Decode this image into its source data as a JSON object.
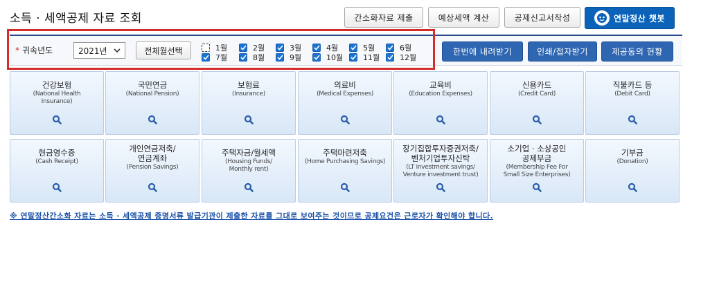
{
  "page": {
    "title": "소득 · 세액공제 자료 조회"
  },
  "header": {
    "simplified_submit": "간소화자료 제출",
    "tax_estimate": "예상세액 계산",
    "deduction_report": "공제신고서작성",
    "chatbot": "연말정산 챗봇"
  },
  "filter": {
    "year_label": "귀속년도",
    "required_mark": "*",
    "year_value": "2021년",
    "select_all": "전체월선택",
    "months": [
      {
        "label": "1월",
        "checked": false
      },
      {
        "label": "2월",
        "checked": true
      },
      {
        "label": "3월",
        "checked": true
      },
      {
        "label": "4월",
        "checked": true
      },
      {
        "label": "5월",
        "checked": true
      },
      {
        "label": "6월",
        "checked": true
      },
      {
        "label": "7월",
        "checked": true
      },
      {
        "label": "8월",
        "checked": true
      },
      {
        "label": "9월",
        "checked": true
      },
      {
        "label": "10월",
        "checked": true
      },
      {
        "label": "11월",
        "checked": true
      },
      {
        "label": "12월",
        "checked": true
      }
    ]
  },
  "actions": {
    "download_all": "한번에 내려받기",
    "print": "인쇄/접자받기",
    "consent_status": "제공동의 현황"
  },
  "tiles": [
    {
      "title": "건강보험",
      "sub": [
        "(National Health",
        "Insurance)"
      ]
    },
    {
      "title": "국민연금",
      "sub": [
        "(National Pension)"
      ]
    },
    {
      "title": "보험료",
      "sub": [
        "(Insurance)"
      ]
    },
    {
      "title": "의료비",
      "sub": [
        "(Medical Expenses)"
      ]
    },
    {
      "title": "교육비",
      "sub": [
        "(Education Expenses)"
      ]
    },
    {
      "title": "신용카드",
      "sub": [
        "(Credit Card)"
      ]
    },
    {
      "title": "직불카드 등",
      "sub": [
        "(Debit Card)"
      ]
    },
    {
      "title": "현금영수증",
      "sub": [
        "(Cash Receipt)"
      ]
    },
    {
      "title": "개인연금저축/\n연금계좌",
      "sub": [
        "(Pension Savings)"
      ]
    },
    {
      "title": "주택자금/월세액",
      "sub": [
        "(Housing Funds/",
        "Monthly rent)"
      ]
    },
    {
      "title": "주택마련저축",
      "sub": [
        "(Home Purchasing Savings)"
      ]
    },
    {
      "title": "장기집합투자증권저축/\n벤처기업투자신탁",
      "sub": [
        "(LT investment savings/",
        "Venture investment trust)"
      ]
    },
    {
      "title": "소기업 · 소상공인\n공제부금",
      "sub": [
        "(Membership Fee For",
        "Small Size Enterprises)"
      ]
    },
    {
      "title": "기부금",
      "sub": [
        "(Donation)"
      ]
    }
  ],
  "notice": "※ 연말정산간소화 자료는 소득 · 세액공제 증명서류 발급기관이 제출한 자료를 그대로 보여주는 것이므로 공제요건은 근로자가 확인해야 합니다."
}
